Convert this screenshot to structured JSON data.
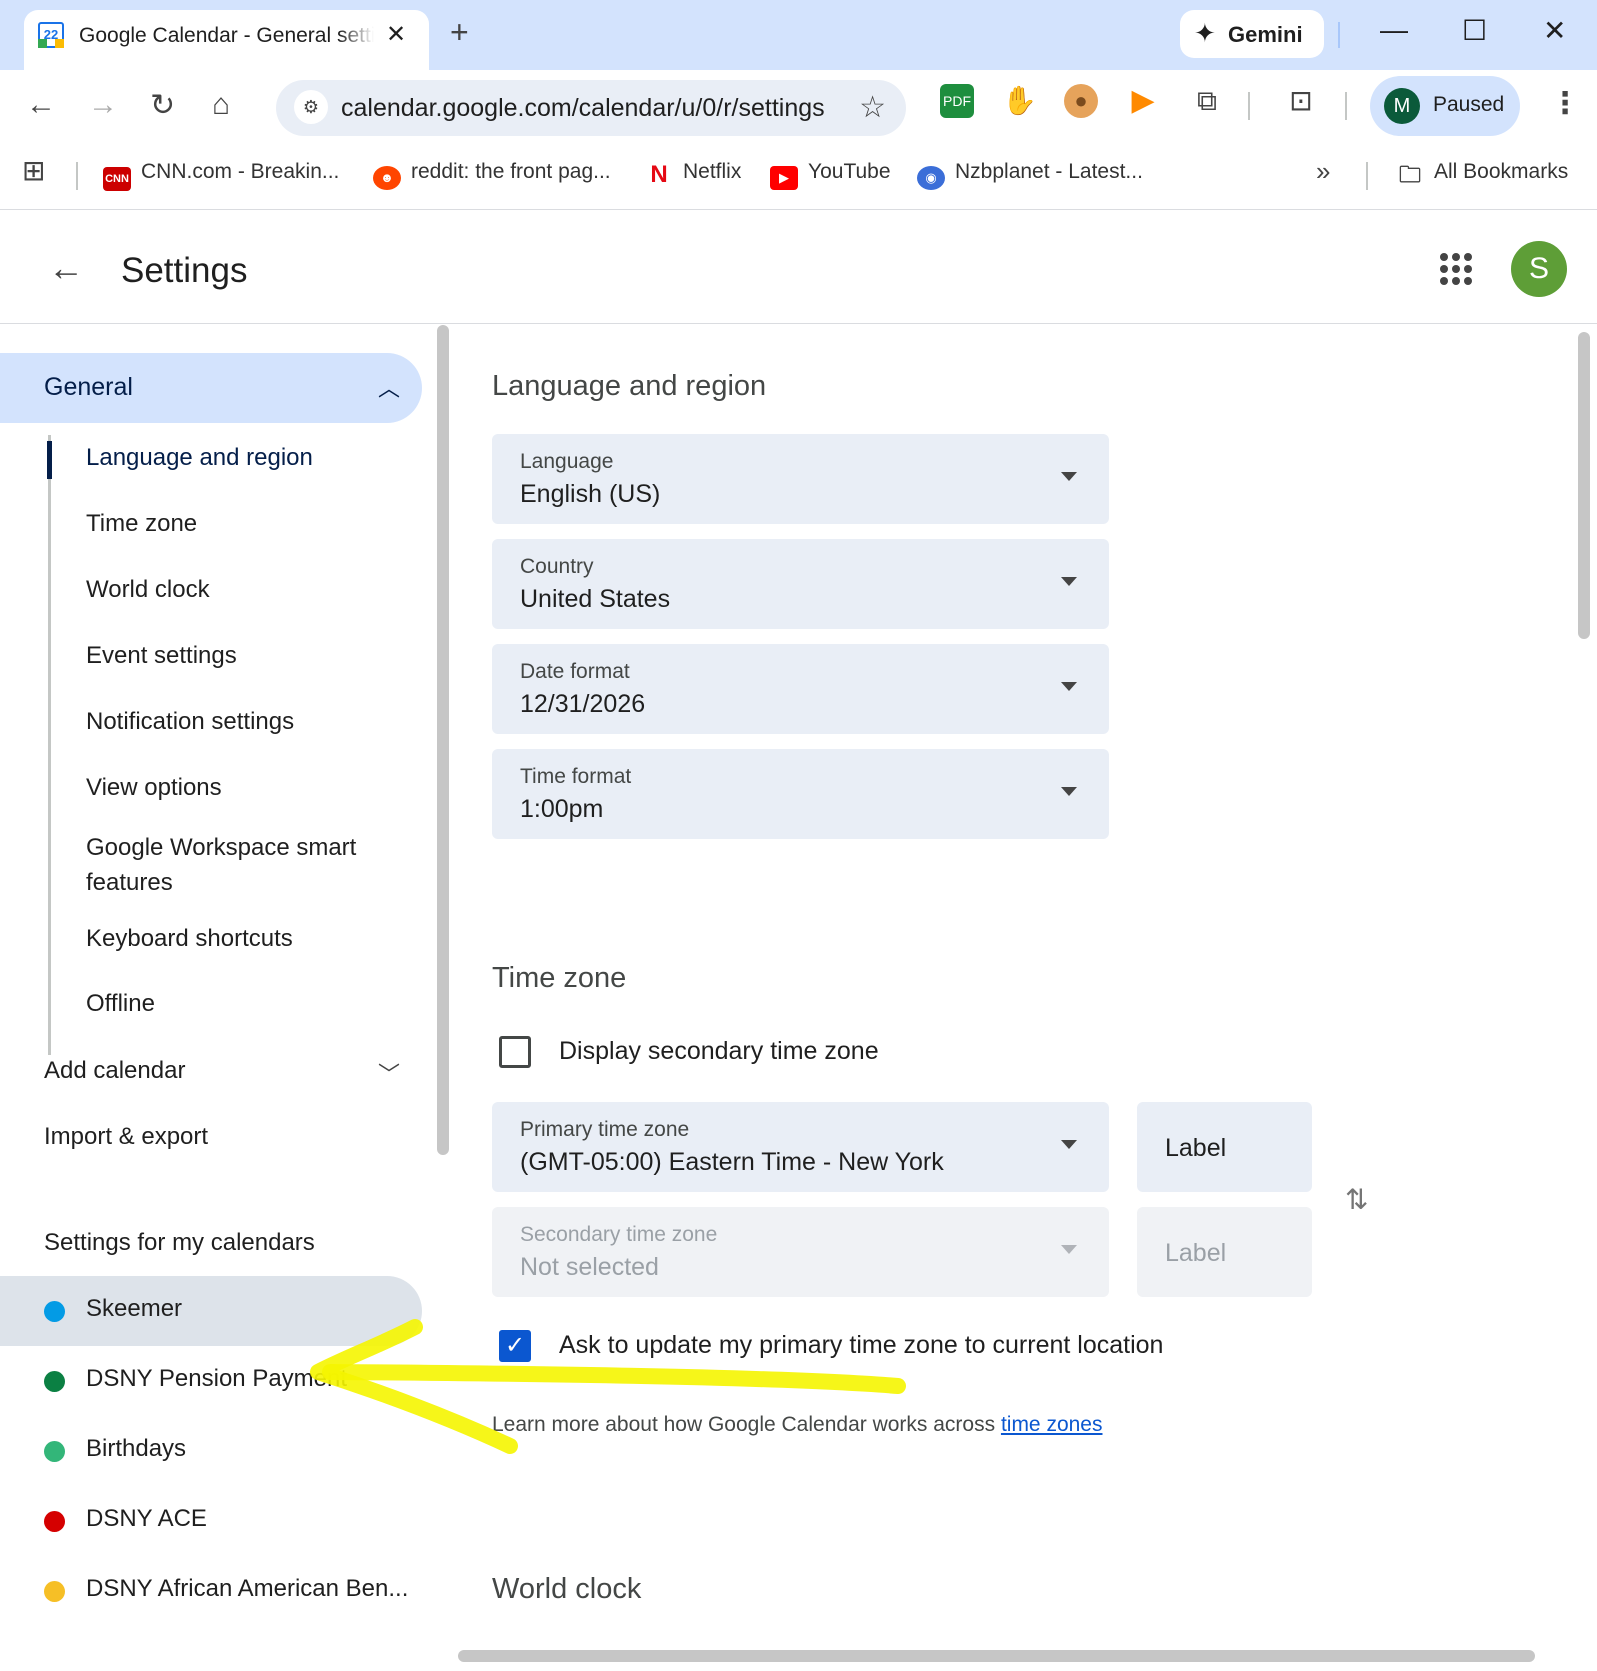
{
  "browser": {
    "tab_title": "Google Calendar - General setti",
    "tab_favicon_text": "22",
    "gemini_label": "Gemini",
    "url": "calendar.google.com/calendar/u/0/r/settings",
    "profile_initial": "M",
    "profile_status": "Paused",
    "bookmarks": [
      {
        "label": "CNN.com - Breakin...",
        "icon_text": "CNN",
        "color": "#cc0000"
      },
      {
        "label": "reddit: the front pag...",
        "icon_text": "",
        "color": "#ff4500"
      },
      {
        "label": "Netflix",
        "icon_text": "N",
        "color": "#e50914"
      },
      {
        "label": "YouTube",
        "icon_text": "",
        "color": "#ff0000"
      },
      {
        "label": "Nzbplanet - Latest...",
        "icon_text": "",
        "color": "#3b6ed8"
      }
    ],
    "all_bookmarks": "All Bookmarks"
  },
  "header": {
    "title": "Settings",
    "user_initial": "S",
    "user_color": "#5e9e37"
  },
  "sidebar": {
    "general": "General",
    "sub_items": [
      "Language and region",
      "Time zone",
      "World clock",
      "Event settings",
      "Notification settings",
      "View options",
      "Google Workspace smart features",
      "Keyboard shortcuts",
      "Offline"
    ],
    "add_calendar": "Add calendar",
    "import_export": "Import & export",
    "my_calendars_heading": "Settings for my calendars",
    "calendars": [
      {
        "name": "Skeemer",
        "color": "#039be5"
      },
      {
        "name": "DSNY Pension Payment",
        "color": "#0b8043"
      },
      {
        "name": "Birthdays",
        "color": "#33b679"
      },
      {
        "name": "DSNY ACE",
        "color": "#d50000"
      },
      {
        "name": "DSNY African American Ben...",
        "color": "#f6bf26"
      }
    ]
  },
  "main": {
    "language_region": {
      "heading": "Language and region",
      "language": {
        "label": "Language",
        "value": "English (US)"
      },
      "country": {
        "label": "Country",
        "value": "United States"
      },
      "date_format": {
        "label": "Date format",
        "value": "12/31/2026"
      },
      "time_format": {
        "label": "Time format",
        "value": "1:00pm"
      }
    },
    "time_zone": {
      "heading": "Time zone",
      "display_secondary": "Display secondary time zone",
      "primary": {
        "label": "Primary time zone",
        "value": "(GMT-05:00) Eastern Time - New York"
      },
      "primary_label": "Label",
      "secondary": {
        "label": "Secondary time zone",
        "value": "Not selected"
      },
      "secondary_label": "Label",
      "ask_update": "Ask to update my primary time zone to current location",
      "learn_more": "Learn more about how Google Calendar works across ",
      "learn_link": "time zones"
    },
    "world_clock": {
      "heading": "World clock"
    }
  },
  "colors": {
    "accent": "#0b57d0",
    "nav_selected": "#d3e3fd",
    "annotation": "#f5f500"
  }
}
